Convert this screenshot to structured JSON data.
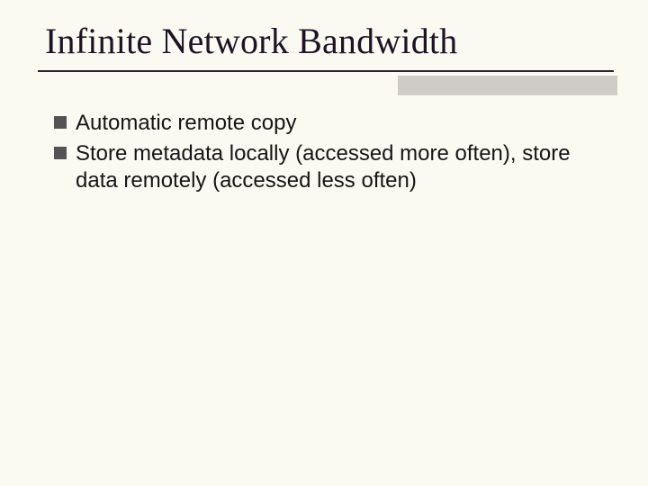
{
  "slide": {
    "title": "Infinite Network Bandwidth",
    "bullets": [
      "Automatic remote copy",
      "Store metadata locally (accessed more often), store data remotely (accessed less often)"
    ]
  }
}
